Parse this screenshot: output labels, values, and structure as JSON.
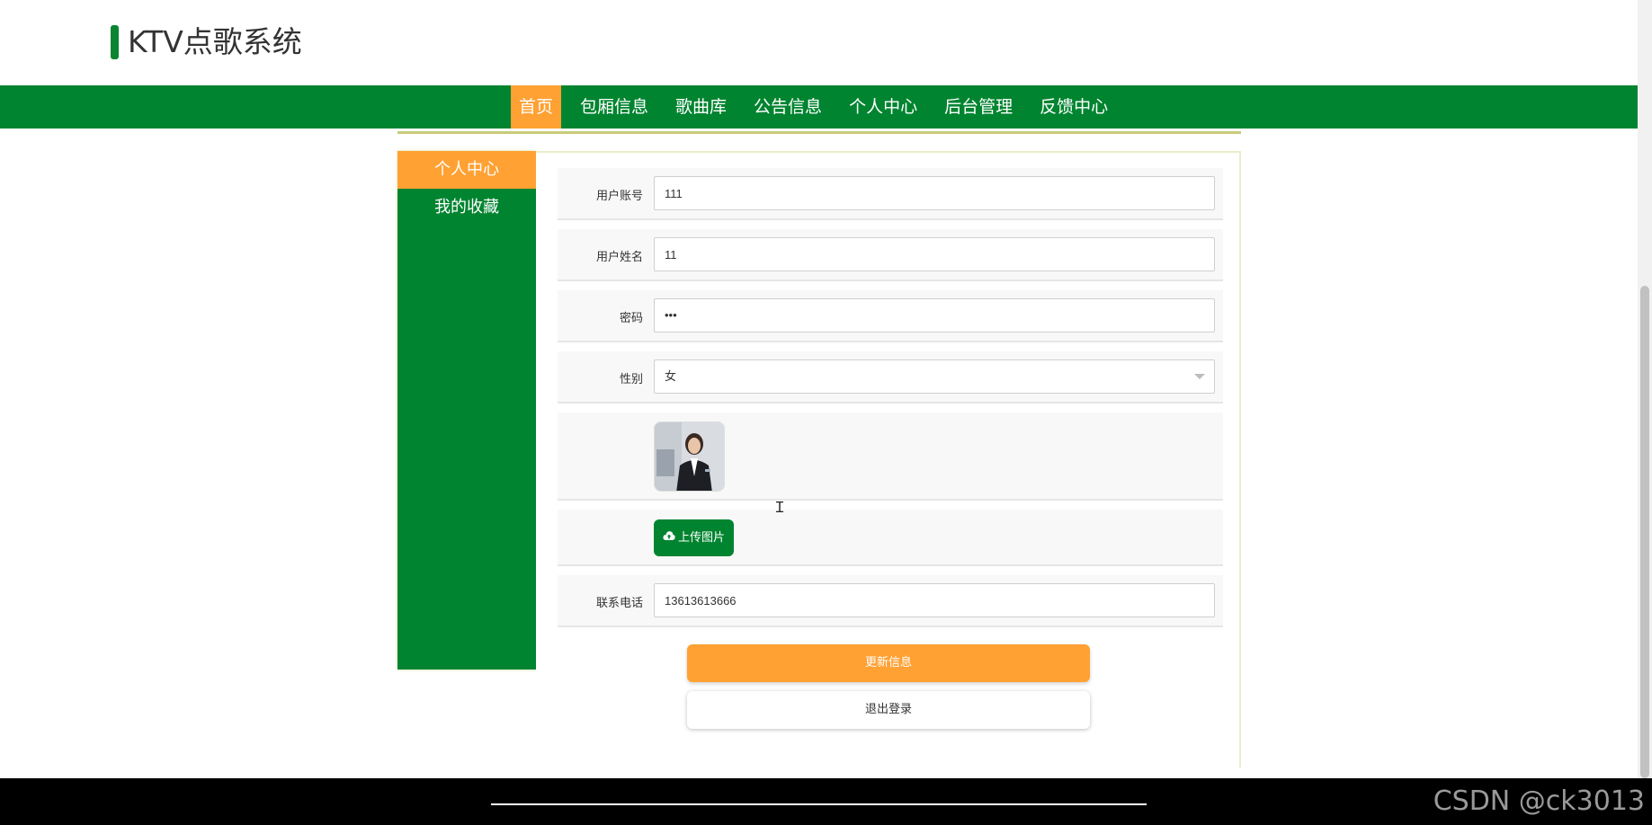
{
  "app": {
    "title": "KTV点歌系统"
  },
  "nav": {
    "items": [
      {
        "label": "首页",
        "active": true
      },
      {
        "label": "包厢信息",
        "active": false
      },
      {
        "label": "歌曲库",
        "active": false
      },
      {
        "label": "公告信息",
        "active": false
      },
      {
        "label": "个人中心",
        "active": false
      },
      {
        "label": "后台管理",
        "active": false
      },
      {
        "label": "反馈中心",
        "active": false
      }
    ]
  },
  "sidebar": {
    "items": [
      {
        "label": "个人中心",
        "active": true
      },
      {
        "label": "我的收藏",
        "active": false
      }
    ]
  },
  "form": {
    "account": {
      "label": "用户账号",
      "value": "111"
    },
    "name": {
      "label": "用户姓名",
      "value": "11"
    },
    "password": {
      "label": "密码",
      "value": "•••"
    },
    "gender": {
      "label": "性别",
      "value": "女"
    },
    "upload_label": "上传图片",
    "phone": {
      "label": "联系电话",
      "value": "13613613666"
    }
  },
  "actions": {
    "update_label": "更新信息",
    "logout_label": "退出登录"
  },
  "watermark": "CSDN @ck3013",
  "colors": {
    "primary": "#008430",
    "accent": "#ffa133"
  },
  "icons": {
    "upload": "cloud-upload-icon",
    "select": "chevron-down-icon"
  }
}
